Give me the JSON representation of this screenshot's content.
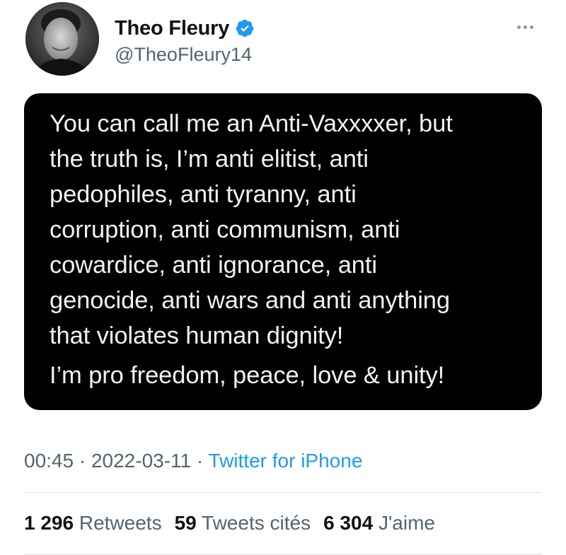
{
  "author": {
    "display_name": "Theo Fleury",
    "handle": "@TheoFleury14",
    "verified": true
  },
  "tweet": {
    "quote_paragraph_1": "You can call me an Anti-Vaxxxxer, but\nthe truth is, I’m anti elitist, anti\npedophiles, anti tyranny, anti\ncorruption, anti communism, anti\ncowardice, anti ignorance, anti\ngenocide, anti wars and anti anything\nthat violates human dignity!",
    "quote_paragraph_2": "I’m pro freedom, peace, love & unity!"
  },
  "meta": {
    "time": "00:45",
    "separator": "·",
    "date": "2022-03-11",
    "source": "Twitter for iPhone"
  },
  "stats": {
    "retweets_count": "1 296",
    "retweets_label": "Retweets",
    "quotes_count": "59",
    "quotes_label": "Tweets cités",
    "likes_count": "6 304",
    "likes_label": "J'aime"
  },
  "colors": {
    "accent": "#1d9bf0",
    "secondary_text": "#536471",
    "card_background": "#000000"
  },
  "icons": [
    "verified-badge-icon",
    "more-options-icon"
  ]
}
